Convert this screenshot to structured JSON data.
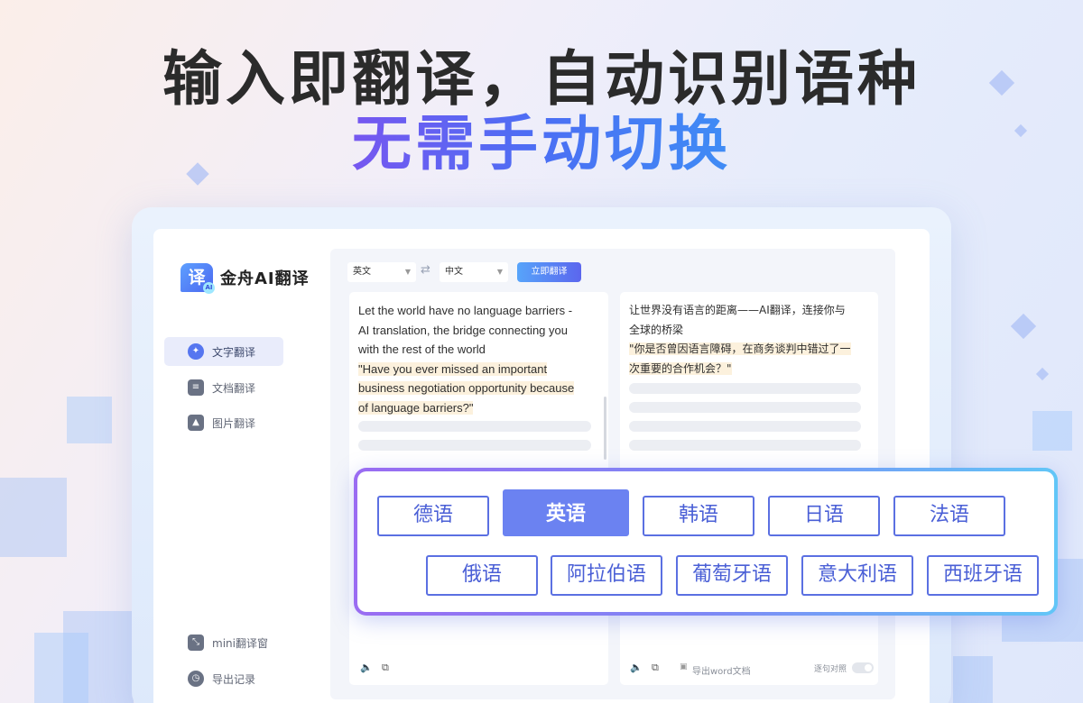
{
  "headline": "输入即翻译，自动识别语种",
  "subheadline": "无需手动切换",
  "app": {
    "logo_glyph": "译",
    "logo_badge": "AI",
    "name": "金舟AI翻译"
  },
  "sidebar": {
    "items": [
      {
        "label": "文字翻译",
        "icon": "ai-translate-icon",
        "active": true
      },
      {
        "label": "文档翻译",
        "icon": "document-icon",
        "active": false
      },
      {
        "label": "图片翻译",
        "icon": "image-icon",
        "active": false
      }
    ],
    "bottom_items": [
      {
        "label": "mini翻译窗",
        "icon": "mini-window-icon"
      },
      {
        "label": "导出记录",
        "icon": "clock-icon"
      }
    ]
  },
  "toolbar": {
    "source_lang": "英文",
    "target_lang": "中文",
    "translate_label": "立即翻译"
  },
  "source": {
    "lines_plain": [
      "Let the world have no language barriers -",
      "AI translation, the bridge connecting you",
      "with the rest of the world"
    ],
    "lines_highlight": [
      "\"Have you ever missed an important",
      "business negotiation opportunity because",
      "of language barriers?\""
    ]
  },
  "target": {
    "lines_plain": [
      "让世界没有语言的距离——AI翻译，连接你与",
      "全球的桥梁"
    ],
    "lines_highlight": [
      "\"你是否曾因语言障碍，在商务谈判中错过了一",
      "次重要的合作机会？\""
    ]
  },
  "footer": {
    "export_word": "导出word文档",
    "sentence_compare": "逐句对照"
  },
  "languages_row1": [
    "德语",
    "英语",
    "韩语",
    "日语",
    "法语"
  ],
  "languages_row2": [
    "俄语",
    "阿拉伯语",
    "葡萄牙语",
    "意大利语",
    "西班牙语"
  ],
  "selected_language": "英语"
}
